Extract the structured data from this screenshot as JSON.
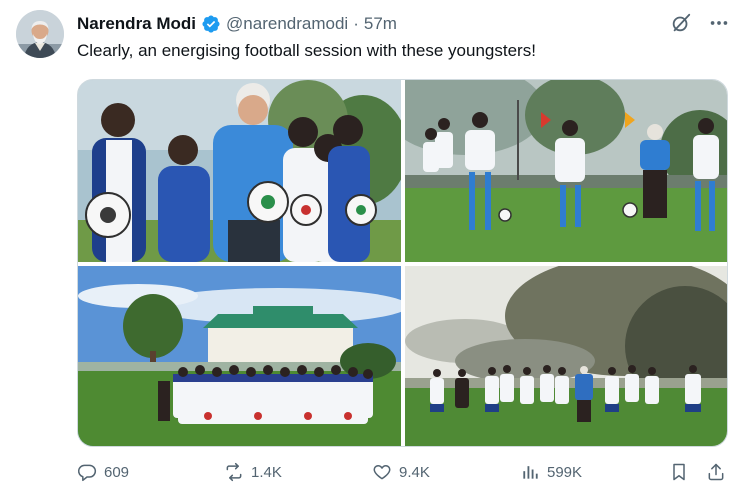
{
  "author": {
    "name": "Narendra Modi",
    "handle": "@narendramodi",
    "separator": "·",
    "time": "57m"
  },
  "post": {
    "text": "Clearly, an energising football session with these youngsters!"
  },
  "media": {
    "photos": [
      {
        "icon": "group-photo-with-footballs"
      },
      {
        "icon": "football-training-on-field"
      },
      {
        "icon": "team-photo-in-front-of-building"
      },
      {
        "icon": "players-on-misty-field"
      }
    ]
  },
  "metrics": {
    "replies": "609",
    "reposts": "1.4K",
    "likes": "9.4K",
    "views": "599K"
  },
  "colors": {
    "text_primary": "#0f1419",
    "text_secondary": "#536471",
    "verified": "#1d9bf0",
    "border": "#cfd9de"
  }
}
